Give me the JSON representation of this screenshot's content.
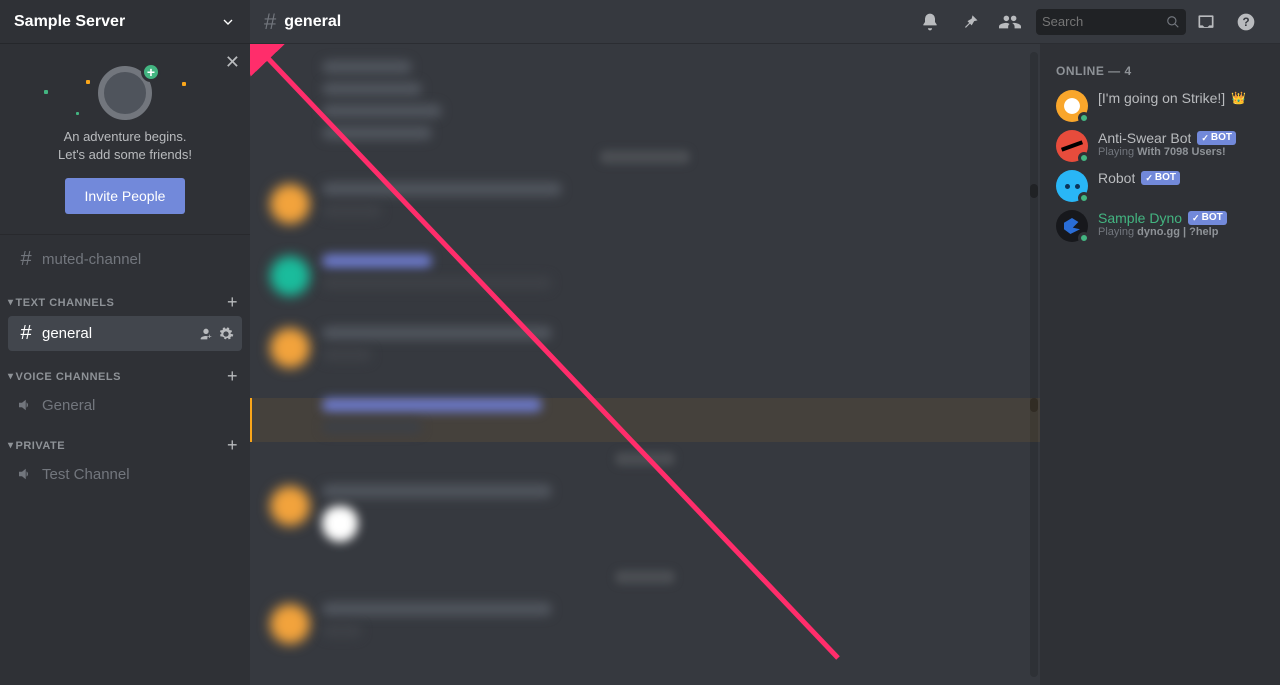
{
  "server": {
    "name": "Sample Server"
  },
  "channel_header": {
    "name": "general",
    "search_placeholder": "Search"
  },
  "welcome": {
    "line1": "An adventure begins.",
    "line2": "Let's add some friends!",
    "invite_label": "Invite People"
  },
  "channels": {
    "muted": {
      "name": "muted-channel"
    },
    "text_category": "TEXT CHANNELS",
    "general": {
      "name": "general"
    },
    "voice_category": "VOICE CHANNELS",
    "voice_general": {
      "name": "General"
    },
    "private_category": "PRIVATE",
    "test_channel": {
      "name": "Test Channel"
    }
  },
  "members_header": "ONLINE — 4",
  "members": [
    {
      "name": "[I'm going on Strike!]",
      "owner": true,
      "bot": false,
      "activity_prefix": "",
      "activity_bold": "",
      "avatar_class": "av-orange",
      "name_color": ""
    },
    {
      "name": "Anti-Swear Bot",
      "owner": false,
      "bot": true,
      "activity_prefix": "Playing ",
      "activity_bold": "With 7098 Users!",
      "avatar_class": "av-red",
      "name_color": ""
    },
    {
      "name": "Robot",
      "owner": false,
      "bot": true,
      "activity_prefix": "",
      "activity_bold": "",
      "avatar_class": "av-blue",
      "name_color": ""
    },
    {
      "name": "Sample Dyno",
      "owner": false,
      "bot": true,
      "activity_prefix": "Playing ",
      "activity_bold": "dyno.gg | ?help",
      "avatar_class": "av-dyno",
      "name_color": "green"
    }
  ],
  "bot_tag_label": "BOT"
}
